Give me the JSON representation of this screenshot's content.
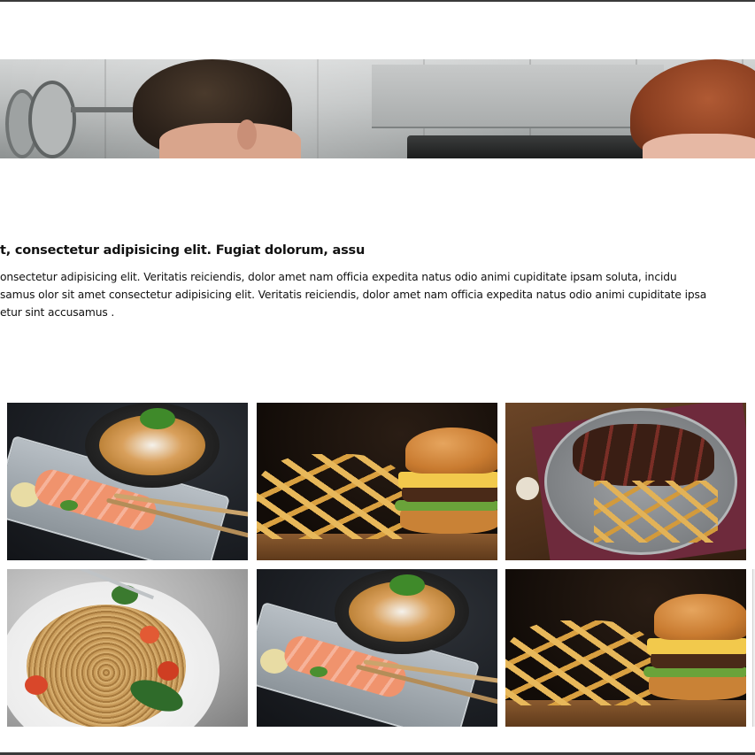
{
  "hero": {
    "image_label": "chefs-cooking-banner"
  },
  "article": {
    "title": "t, consectetur adipisicing elit. Fugiat dolorum, assu",
    "body_lines": [
      "onsectetur adipisicing elit. Veritatis reiciendis, dolor amet nam officia expedita natus odio animi cupiditate ipsam soluta, incidu",
      "samus olor sit amet consectetur adipisicing elit. Veritatis reiciendis, dolor amet nam officia expedita natus odio animi cupiditate ipsa",
      "etur sint accusamus ."
    ]
  },
  "gallery": {
    "items": [
      {
        "name": "salmon-sashimi-with-noodle-bowl"
      },
      {
        "name": "burger-and-fries"
      },
      {
        "name": "sliced-steak-with-fries"
      },
      {
        "name": "spaghetti-with-tomatoes"
      },
      {
        "name": "salmon-sashimi-with-noodle-bowl"
      },
      {
        "name": "burger-and-fries"
      }
    ]
  },
  "colors": {
    "page_background": "#ffffff",
    "rule": "#3a3a3a",
    "text": "#111111"
  }
}
